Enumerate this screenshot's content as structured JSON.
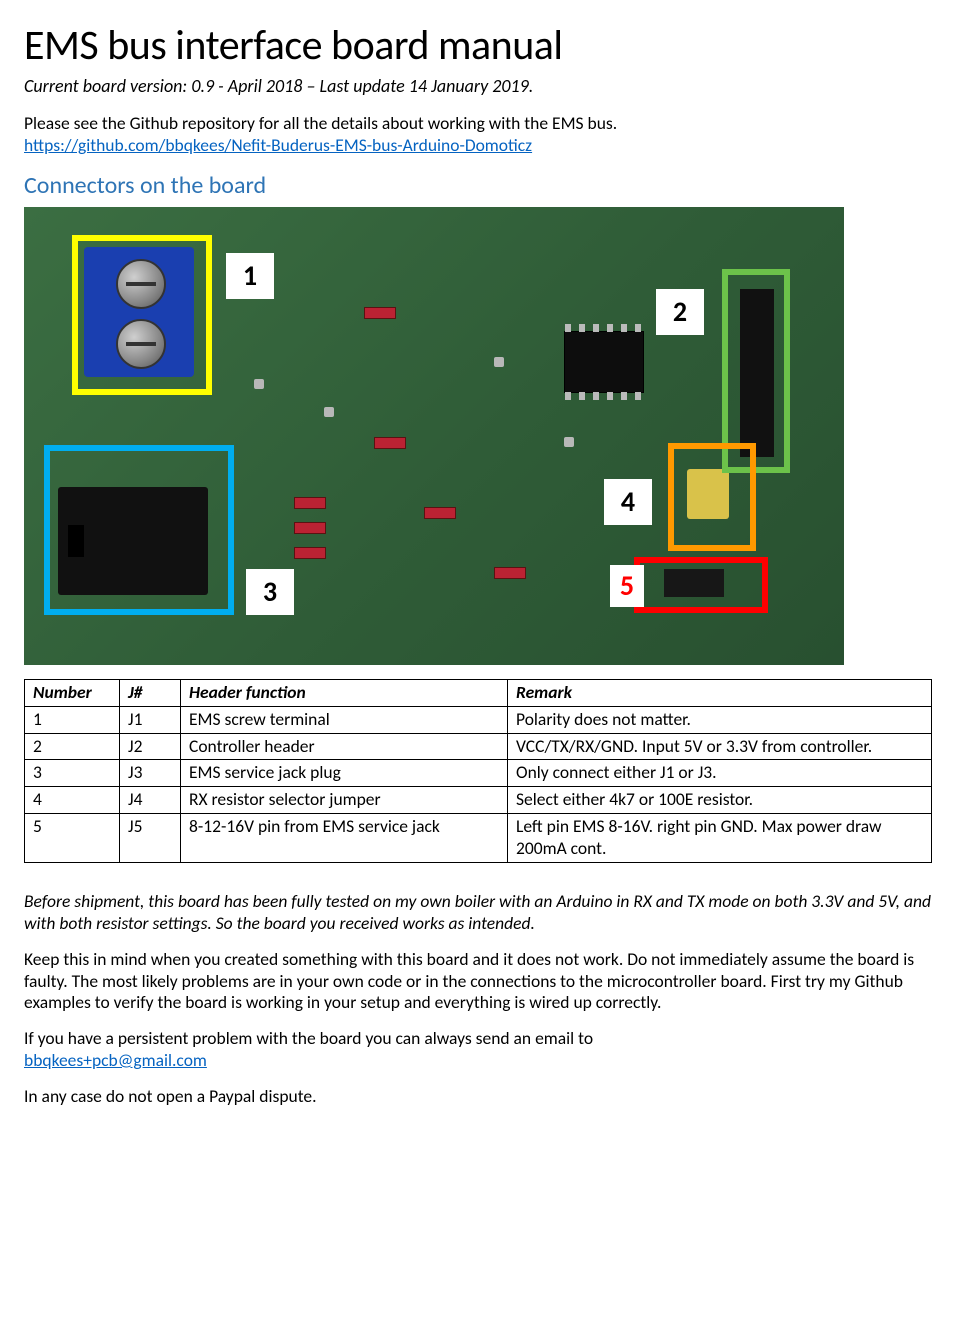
{
  "title": "EMS bus interface board manual",
  "subtitle": "Current board version: 0.9 - April 2018 – Last update 14 January 2019.",
  "intro_line": "Please see the Github repository for all the details about working with the EMS bus.",
  "github_url": "https://github.com/bbqkees/Nefit-Buderus-EMS-bus-Arduino-Domoticz",
  "section_connectors": "Connectors on the board",
  "badges": {
    "b1": "1",
    "b2": "2",
    "b3": "3",
    "b4": "4",
    "b5": "5"
  },
  "table": {
    "headers": {
      "num": "Number",
      "j": "J#",
      "fn": "Header function",
      "remark": "Remark"
    },
    "rows": [
      {
        "num": "1",
        "j": "J1",
        "fn": "EMS screw terminal",
        "remark": "Polarity does not matter."
      },
      {
        "num": "2",
        "j": "J2",
        "fn": "Controller header",
        "remark": "VCC/TX/RX/GND. Input 5V or 3.3V from controller."
      },
      {
        "num": "3",
        "j": "J3",
        "fn": "EMS service jack plug",
        "remark": "Only connect either J1 or J3."
      },
      {
        "num": "4",
        "j": "J4",
        "fn": "RX resistor selector jumper",
        "remark": "Select either 4k7 or 100E resistor."
      },
      {
        "num": "5",
        "j": "J5",
        "fn": "8-12-16V pin from EMS service jack",
        "remark": "Left pin EMS 8-16V. right pin GND. Max power draw 200mA cont."
      }
    ]
  },
  "tested_note": "Before shipment, this board has been fully tested on my own boiler with an Arduino in RX and TX mode on both 3.3V and 5V, and with both resistor settings. So the board you received works as intended.",
  "keep_in_mind": "Keep this in mind when you created something with this board and it does not work. Do not immediately assume the board is faulty. The most likely problems are in your own code or in the connections to the microcontroller board. First try my Github examples to verify the board is working in your setup and everything is wired up correctly.",
  "persist_line_a": "If you have a persistent problem with the board you can always send an email to ",
  "contact_email": "bbqkees+pcb@gmail.com",
  "paypal_line": "In any case do not open a Paypal dispute."
}
